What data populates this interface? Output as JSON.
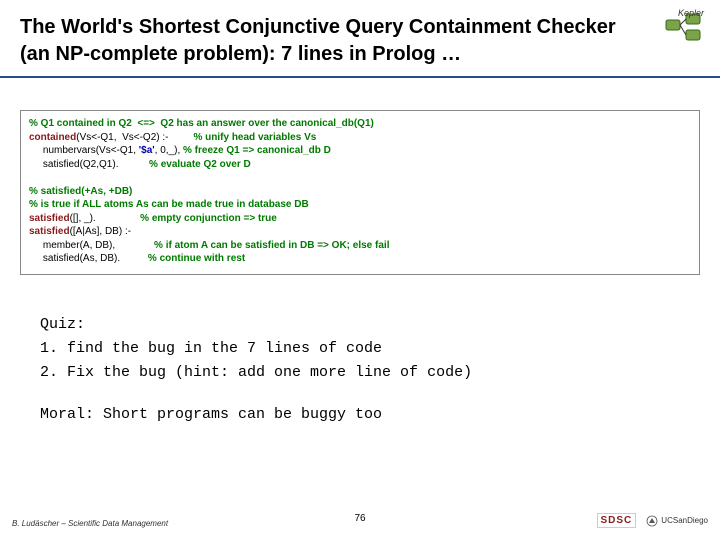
{
  "header": {
    "title": "The World's Shortest Conjunctive Query Containment Checker (an NP-complete problem): 7 lines in Prolog …",
    "logo_text": "Kepler"
  },
  "code": {
    "l1_cmt": "% Q1 contained in Q2  <=>  Q2 has an answer over the canonical_db(Q1)",
    "l2_pred": "contained",
    "l2_rest_a": "(Vs<-Q1,  Vs<-Q2) :-         ",
    "l2_cmt": "% unify head variables Vs",
    "l3_a": "     numbervars(Vs<-Q1, ",
    "l3_str": "'$a'",
    "l3_b": ", 0,_), ",
    "l3_cmt": "% freeze Q1 => canonical_db D",
    "l4_a": "     satisfied(Q2,Q1).           ",
    "l4_cmt": "% evaluate Q2 over D",
    "l6_cmt": "% satisfied(+As, +DB)",
    "l7_cmt": "% is true if ALL atoms As can be made true in database DB",
    "l8_pred": "satisfied",
    "l8_a": "([], _).                ",
    "l8_cmt": "% empty conjunction => true",
    "l9_pred": "satisfied",
    "l9_a": "([A|As], DB) :-",
    "l10_a": "     member(A, DB),              ",
    "l10_cmt": "% if atom A can be satisfied in DB => OK; else fail",
    "l11_a": "     satisfied(As, DB).          ",
    "l11_cmt": "% continue with rest"
  },
  "quiz": {
    "heading": "Quiz:",
    "item1": "1. find the bug in the 7 lines of code",
    "item2": "2. Fix the bug (hint: add one more line of code)",
    "moral": "Moral: Short programs can be buggy too"
  },
  "footer": {
    "left": "B. Ludäscher – Scientific Data Management",
    "page": "76",
    "sdsc": "SDSC",
    "ucsd": "UCSanDiego"
  }
}
